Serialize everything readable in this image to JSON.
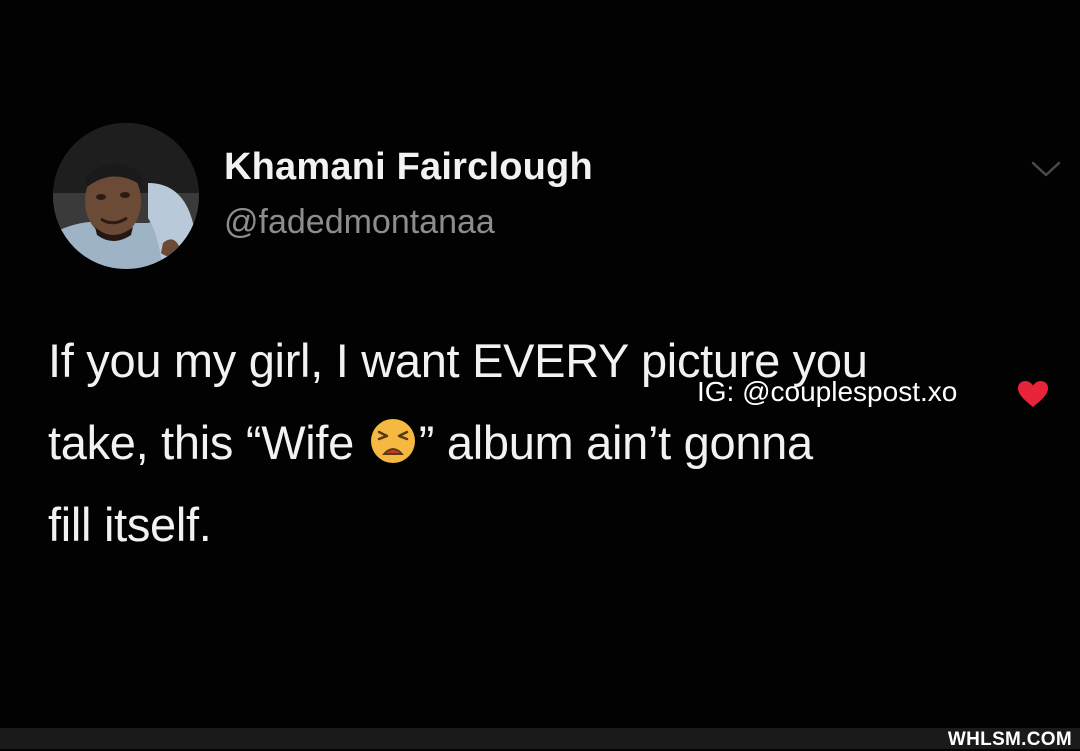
{
  "tweet": {
    "display_name": "Khamani Fairclough",
    "handle": "@fadedmontanaa",
    "avatar_icon": "user-avatar-photo",
    "menu_icon": "chevron-down-icon",
    "text_lines": [
      "If you my girl, I want EVERY picture you",
      "take, this “Wife",
      "” album ain’t gonna",
      "fill itself."
    ],
    "emoji_icon": "weary-face-emoji"
  },
  "overlay": {
    "ig_credit": "IG: @couplespost.xo",
    "heart_icon": "red-heart-emoji",
    "site_logo": "WHLSM.COM"
  },
  "colors": {
    "background": "#000000",
    "text_primary": "#f2f2f2",
    "text_secondary": "#8d8d8d",
    "heart": "#e8243a"
  }
}
